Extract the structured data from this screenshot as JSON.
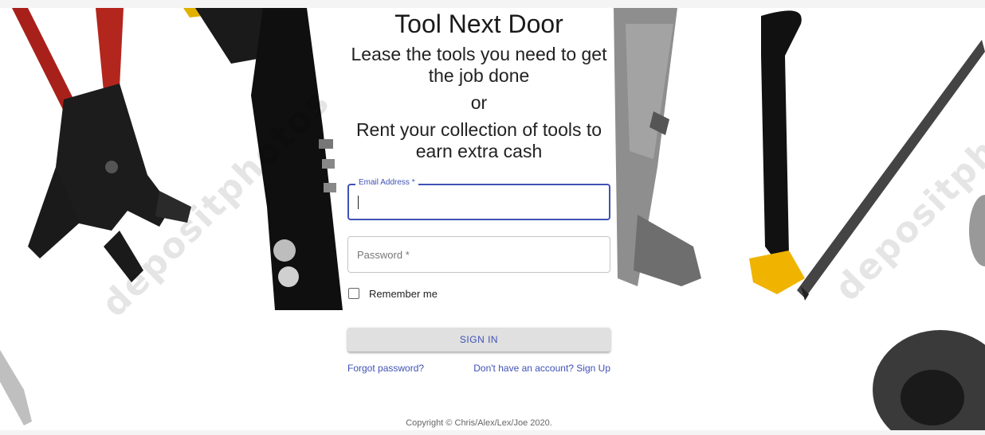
{
  "header": {
    "title": "Tool Next Door",
    "tagline_lease": "Lease the tools you need to get the job done",
    "tagline_or": "or",
    "tagline_rent": "Rent your collection of tools to earn extra cash"
  },
  "form": {
    "email_label": "Email Address *",
    "email_value": "",
    "password_placeholder": "Password *",
    "remember_label": "Remember me",
    "remember_checked": false,
    "signin_label": "SIGN IN",
    "forgot_link": "Forgot password?",
    "signup_link": "Don't have an account? Sign Up"
  },
  "footer": {
    "copyright": "Copyright © Chris/Alex/Lex/Joe 2020."
  },
  "background": {
    "watermark": "depositphotos",
    "icons": [
      "pliers-icon",
      "rivet-gun-icon",
      "caliper-icon",
      "hacksaw-icon",
      "wrench-socket-icon"
    ]
  },
  "colors": {
    "accent": "#3f51b5",
    "button_bg": "#e0e0e0"
  }
}
